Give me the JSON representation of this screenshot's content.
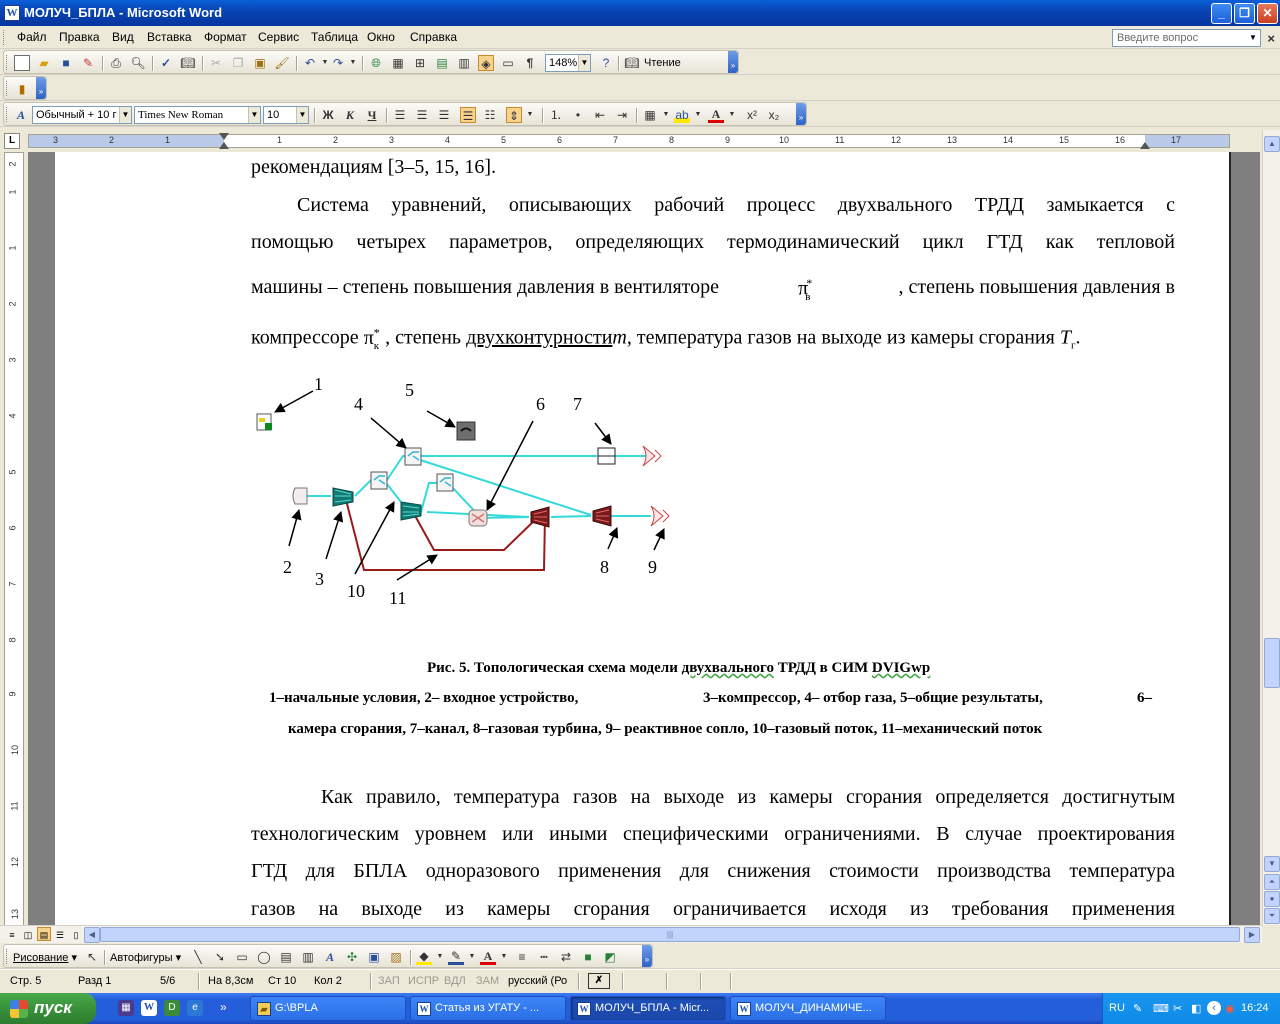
{
  "window": {
    "title": "МОЛУЧ_БПЛА - Microsoft Word",
    "minimize": "_",
    "maximize": "❐",
    "close": "✕"
  },
  "menubar": {
    "items": [
      "Файл",
      "Правка",
      "Вид",
      "Вставка",
      "Формат",
      "Сервис",
      "Таблица",
      "Окно",
      "Справка"
    ],
    "help_placeholder": "Введите вопрос"
  },
  "toolbar": {
    "zoom": "148%",
    "reading_label": "Чтение"
  },
  "formatting": {
    "style": "Обычный + 10 г",
    "font": "Times New Roman",
    "size": "10"
  },
  "ruler": {
    "numbers": [
      "3",
      "2",
      "1",
      "1",
      "2",
      "3",
      "4",
      "5",
      "6",
      "7",
      "8",
      "9",
      "10",
      "11",
      "12",
      "13",
      "14",
      "15",
      "16",
      "17"
    ],
    "vnumbers": [
      "2",
      "1",
      "1",
      "2",
      "3",
      "4",
      "5",
      "6",
      "7",
      "8",
      "9",
      "10",
      "11",
      "12",
      "13",
      "14",
      "15"
    ]
  },
  "document": {
    "lines": [
      "рекомендациям [3–5, 15, 16].",
      "Система уравнений, описывающих рабочий процесс двухвального ТРДД замыкается с",
      "помощью четырех параметров, определяющих термодинамический цикл ГТД как тепловой",
      "машины – степень повышения давления в вентиляторе",
      ", степень повышения давления в",
      "компрессоре",
      ", степень",
      "двухконтурности",
      ", температура газов на выходе из камеры сгорания",
      ".",
      "Как правило, температура газов на выходе из камеры сгорания определяется достигнутым",
      "технологическим уровнем или иными специфическими ограничениями. В случае проектирования",
      "ГТД для БПЛА одноразового применения для снижения стоимости производства температура",
      "газов на выходе из камеры сгорания ограничивается исходя из требования применения"
    ],
    "math": {
      "pi": "π",
      "star": "*",
      "sub_v": "в",
      "sub_k": "к",
      "m": "m",
      "T": "T",
      "sub_g": "г"
    }
  },
  "figure": {
    "labels": [
      "1",
      "2",
      "3",
      "4",
      "5",
      "6",
      "7",
      "8",
      "9",
      "10",
      "11"
    ],
    "caption_prefix": "Рис. 5. Топологическая схема модели",
    "caption_word": "двухвального",
    "caption_mid": "ТРДД в СИМ",
    "caption_sim": "DVIGwp",
    "legend_line1_a": "1–начальные условия, 2– входное устройство,",
    "legend_line1_b": "3–компрессор, 4– отбор газа, 5–общие результаты,",
    "legend_line1_c": "6–",
    "legend_line2": "камера сгорания, 7–канал, 8–газовая турбина,  9– реактивное сопло, 10–газовый поток, 11–механический поток",
    "colors": {
      "gas": "#35d9d9",
      "mech": "#9b1a1a",
      "arrow": "#000000"
    }
  },
  "drawing_toolbar": {
    "draw": "Рисование",
    "autoshapes": "Автофигуры"
  },
  "statusbar": {
    "page": "Стр.  5",
    "section": "Разд  1",
    "pages": "5/6",
    "position": "На 8,3см",
    "line": "Ст  10",
    "column": "Кол  2",
    "rec": "ЗАП",
    "trk": "ИСПР",
    "ext": "ВДЛ",
    "ovr": "ЗАМ",
    "language": "русский (Ро"
  },
  "taskbar": {
    "start": "пуск",
    "windows": [
      "G:\\BPLA",
      "Статья из УГАТУ - ...",
      "МОЛУЧ_БПЛА - Micr...",
      "МОЛУЧ_ДИНАМИЧЕ..."
    ],
    "lang": "RU",
    "clock": "16:24"
  }
}
